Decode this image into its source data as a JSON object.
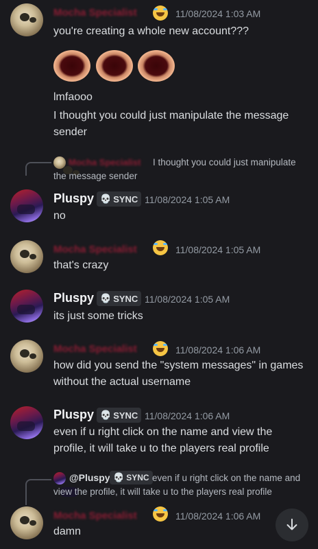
{
  "messages": [
    {
      "timestamp": "11/08/2024 1:03 AM",
      "lines": [
        "you're creating a whole new account???"
      ],
      "followups": [
        "lmfaooo",
        "I thought you could just manipulate the message",
        "sender"
      ]
    },
    {
      "reply_preview": "I thought you could just manipulate the message sender",
      "author": "Pluspy",
      "badge": "SYNC",
      "timestamp": "11/08/2024 1:05 AM",
      "text": "no"
    },
    {
      "timestamp": "11/08/2024 1:05 AM",
      "text": "that's crazy"
    },
    {
      "author": "Pluspy",
      "badge": "SYNC",
      "timestamp": "11/08/2024 1:05 AM",
      "text": "its just some tricks"
    },
    {
      "timestamp": "11/08/2024 1:06 AM",
      "lines": [
        "how did you send the \"system messages\" in games",
        "without the actual username"
      ]
    },
    {
      "author": "Pluspy",
      "badge": "SYNC",
      "timestamp": "11/08/2024 1:06 AM",
      "lines": [
        "even if u right click on the name and view the",
        "profile, it will take u to the players real profile"
      ]
    },
    {
      "reply_mention": "@Pluspy",
      "reply_badge": "SYNC",
      "reply_preview": [
        "even if u right click on the name and",
        "view the profile, it will take u to the players real profile"
      ],
      "timestamp": "11/08/2024 1:06 AM",
      "text": "damn"
    }
  ],
  "colors": {
    "background": "#1a1a1e",
    "redacted_name": "#8a1d33",
    "timestamp": "#949ba4"
  },
  "icons": {
    "scroll_down": "arrow-down-icon",
    "badge": "skull-icon",
    "reaction": "rofl-emoji-icon"
  }
}
